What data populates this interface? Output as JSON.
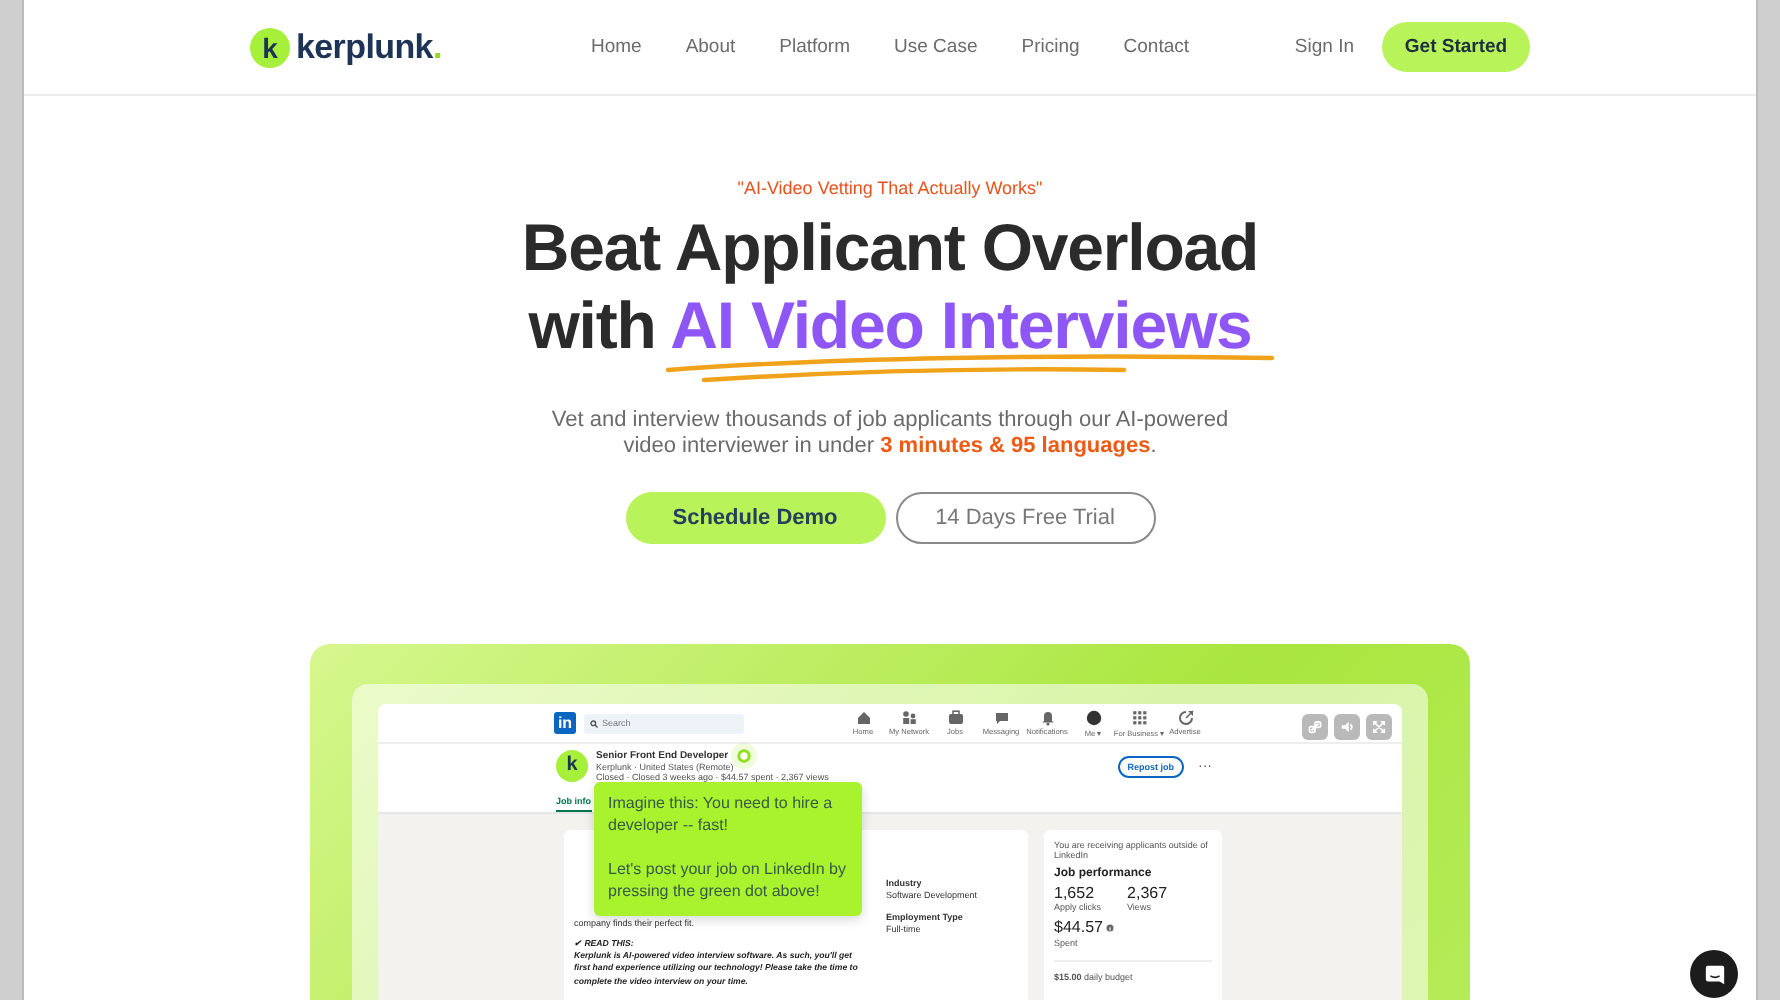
{
  "header": {
    "logo_mark": "k",
    "brand": "kerplunk.",
    "links": [
      "Home",
      "About",
      "Platform",
      "Use Case",
      "Pricing",
      "Contact"
    ],
    "sign_in": "Sign In",
    "cta": "Get Started"
  },
  "hero": {
    "tagline": "\"AI-Video Vetting That Actually Works\"",
    "title_line_1": "Beat Applicant Overload",
    "title_line_2_lead": "with",
    "title_line_2_highlight": "AI Video Interviews",
    "subtitle": "Vet and interview thousands of job applicants through our AI-powered video interviewer in under **3 minutes & 95 languages**.",
    "buttons": [
      {
        "label": "Schedule Demo",
        "kind": "primary"
      },
      {
        "label": "14 Days Free Trial",
        "kind": "outline"
      }
    ]
  },
  "demo": {
    "topbar": {
      "logo": "in",
      "search_placeholder": "Search",
      "nav": [
        "Home",
        "My Network",
        "Jobs",
        "Messaging",
        "Notifications",
        "Me ▾",
        "For Business ▾",
        "Advertise"
      ]
    },
    "job": {
      "avatar_mark": "k",
      "title": "Senior Front End Developer",
      "company": "Kerplunk · United States (Remote)",
      "meta": "Closed · Closed 3 weeks ago · $44.57 spent · 2,367 views",
      "repost": "Repost job",
      "more": "···",
      "tab": "Job info"
    },
    "details": {
      "description_tail": "company finds their perfect fit.",
      "read_this": "✔ READ THIS:",
      "read_body": "Kerplunk is AI-powered video interview software. As such, you'll get first hand experience utilizing our technology! Please take the time to complete the video interview on your time.",
      "fields": [
        {
          "label": "Industry",
          "value": "Software Development"
        },
        {
          "label": "Employment Type",
          "value": "Full-time"
        }
      ]
    },
    "performance": {
      "notice": "You are receiving applicants outside of LinkedIn",
      "title": "Job performance",
      "stats": [
        {
          "value": "1,652",
          "label": "Apply clicks"
        },
        {
          "value": "2,367",
          "label": "Views"
        }
      ],
      "spent": "$44.57",
      "spent_label": "Spent",
      "budget": "**$15.00** daily budget"
    },
    "tooltip": {
      "paragraphs": [
        "Imagine this: You need to hire a developer -- fast!",
        "Let's post your job on LinkedIn by pressing the green dot above!"
      ]
    }
  }
}
